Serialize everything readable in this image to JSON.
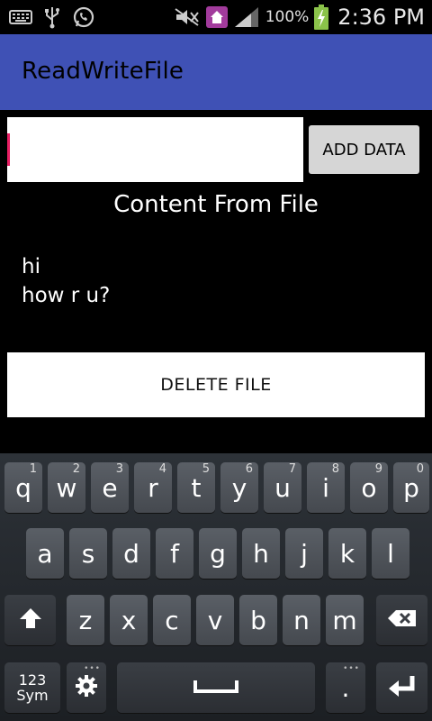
{
  "status_bar": {
    "icons_left": [
      "keyboard-icon",
      "usb-icon",
      "whatsapp-icon"
    ],
    "icons_right": [
      "mute-icon",
      "home-notification-icon",
      "signal-icon",
      "battery-charging-icon"
    ],
    "battery": "100%",
    "time": "2:36 PM"
  },
  "app_bar": {
    "title": "ReadWriteFile"
  },
  "input": {
    "value": ""
  },
  "add_button": {
    "label": "ADD DATA"
  },
  "content_title": "Content From File",
  "file_content": {
    "line1": "hi",
    "line2": "how r u?"
  },
  "delete_button": {
    "label": "DELETE FILE"
  },
  "keyboard": {
    "row1": [
      {
        "key": "q",
        "num": "1"
      },
      {
        "key": "w",
        "num": "2"
      },
      {
        "key": "e",
        "num": "3"
      },
      {
        "key": "r",
        "num": "4"
      },
      {
        "key": "t",
        "num": "5"
      },
      {
        "key": "y",
        "num": "6"
      },
      {
        "key": "u",
        "num": "7"
      },
      {
        "key": "i",
        "num": "8"
      },
      {
        "key": "o",
        "num": "9"
      },
      {
        "key": "p",
        "num": "0"
      }
    ],
    "row2": [
      "a",
      "s",
      "d",
      "f",
      "g",
      "h",
      "j",
      "k",
      "l"
    ],
    "row3": [
      "z",
      "x",
      "c",
      "v",
      "b",
      "n",
      "m"
    ],
    "sym_line1": "123",
    "sym_line2": "Sym",
    "period": ".",
    "icons": [
      "shift-icon",
      "backspace-icon",
      "settings-icon",
      "space-icon",
      "enter-icon"
    ]
  },
  "colors": {
    "app_bar": "#3f51b5",
    "cursor": "#e91e63",
    "battery": "#8bc34a"
  }
}
